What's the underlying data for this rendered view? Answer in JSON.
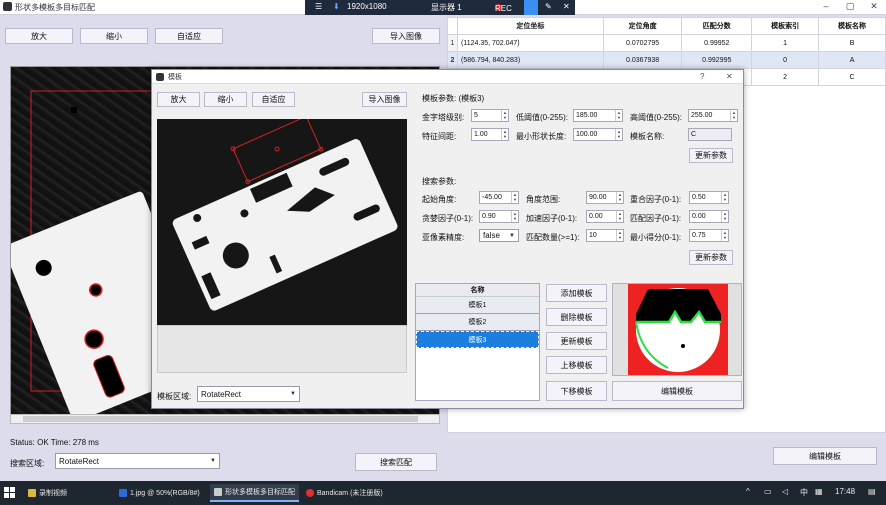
{
  "main_window": {
    "title": "形状多模板多目标匹配",
    "buttons": {
      "zoom_in": "放大",
      "zoom_out": "缩小",
      "fit": "自适应",
      "import": "导入图像"
    },
    "status": "Status: OK Time: 278 ms",
    "search_region_label": "搜索区域:",
    "search_region_value": "RotateRect",
    "search_match_button": "搜索匹配",
    "edit_template_button": "编辑模板"
  },
  "recorder": {
    "resolution": "1920x1080",
    "display": "显示器 1",
    "rec": "REC"
  },
  "results": {
    "headers": [
      "定位坐标",
      "定位角度",
      "匹配分数",
      "模板索引",
      "模板名称"
    ],
    "rows": [
      {
        "num": "1",
        "coord": "(1124.35, 702.047)",
        "angle": "0.0702795",
        "score": "0.99952",
        "index": "1",
        "name": "B"
      },
      {
        "num": "2",
        "coord": "(586.794, 840.283)",
        "angle": "0.0367938",
        "score": "0.992995",
        "index": "0",
        "name": "A"
      },
      {
        "num": "",
        "coord": "",
        "angle": "",
        "score": "",
        "index": "2",
        "name": "C"
      }
    ]
  },
  "dialog": {
    "title": "模板",
    "help": "?",
    "close": "✕",
    "buttons": {
      "zoom_in": "放大",
      "zoom_out": "缩小",
      "fit": "自适应",
      "import": "导入图像"
    },
    "template_params_title": "模板参数: (模板3)",
    "template_params": {
      "pyramid_label": "金字塔级别:",
      "pyramid_value": "5",
      "low_thresh_label": "低阈值(0-255):",
      "low_thresh_value": "185.00",
      "high_thresh_label": "高阈值(0-255):",
      "high_thresh_value": "255.00",
      "feature_spacing_label": "特征间距:",
      "feature_spacing_value": "1.00",
      "min_len_label": "最小形状长度:",
      "min_len_value": "100.00",
      "name_label": "模板名称:",
      "name_value": "C",
      "update_button": "更新参数"
    },
    "search_params_title": "搜索参数:",
    "search_params": {
      "start_angle_label": "起始角度:",
      "start_angle_value": "-45.00",
      "angle_range_label": "角度范围:",
      "angle_range_value": "90.00",
      "overlap_label": "重合因子(0-1):",
      "overlap_value": "0.50",
      "greed_label": "贪婪因子(0-1):",
      "greed_value": "0.90",
      "accel_label": "加速因子(0-1):",
      "accel_value": "0.00",
      "match_factor_label": "匹配因子(0-1):",
      "match_factor_value": "0.00",
      "subpixel_label": "亚像素精度:",
      "subpixel_value": "false",
      "match_count_label": "匹配数量(>=1):",
      "match_count_value": "10",
      "min_score_label": "最小得分(0-1):",
      "min_score_value": "0.75",
      "update_button": "更新参数"
    },
    "list_header": "名称",
    "list_items": [
      "模板1",
      "模板2",
      "模板3"
    ],
    "actions": {
      "add": "添加模板",
      "delete": "删除模板",
      "update": "更新模板",
      "up": "上移模板",
      "down": "下移模板",
      "edit": "编辑模板"
    },
    "region_label": "模板区域:",
    "region_value": "RotateRect"
  },
  "taskbar": {
    "items": [
      "录制视频",
      "1.jpg @ 50%(RGB/8#)",
      "形状多模板多目标匹配",
      "Bandicam (未注册版)"
    ],
    "ime": "中",
    "time": "17:48"
  },
  "colors": {
    "accent": "#1c7fe0",
    "rec_red": "#e22222",
    "roi_red": "#d42020",
    "contour_green": "#28e03a"
  }
}
